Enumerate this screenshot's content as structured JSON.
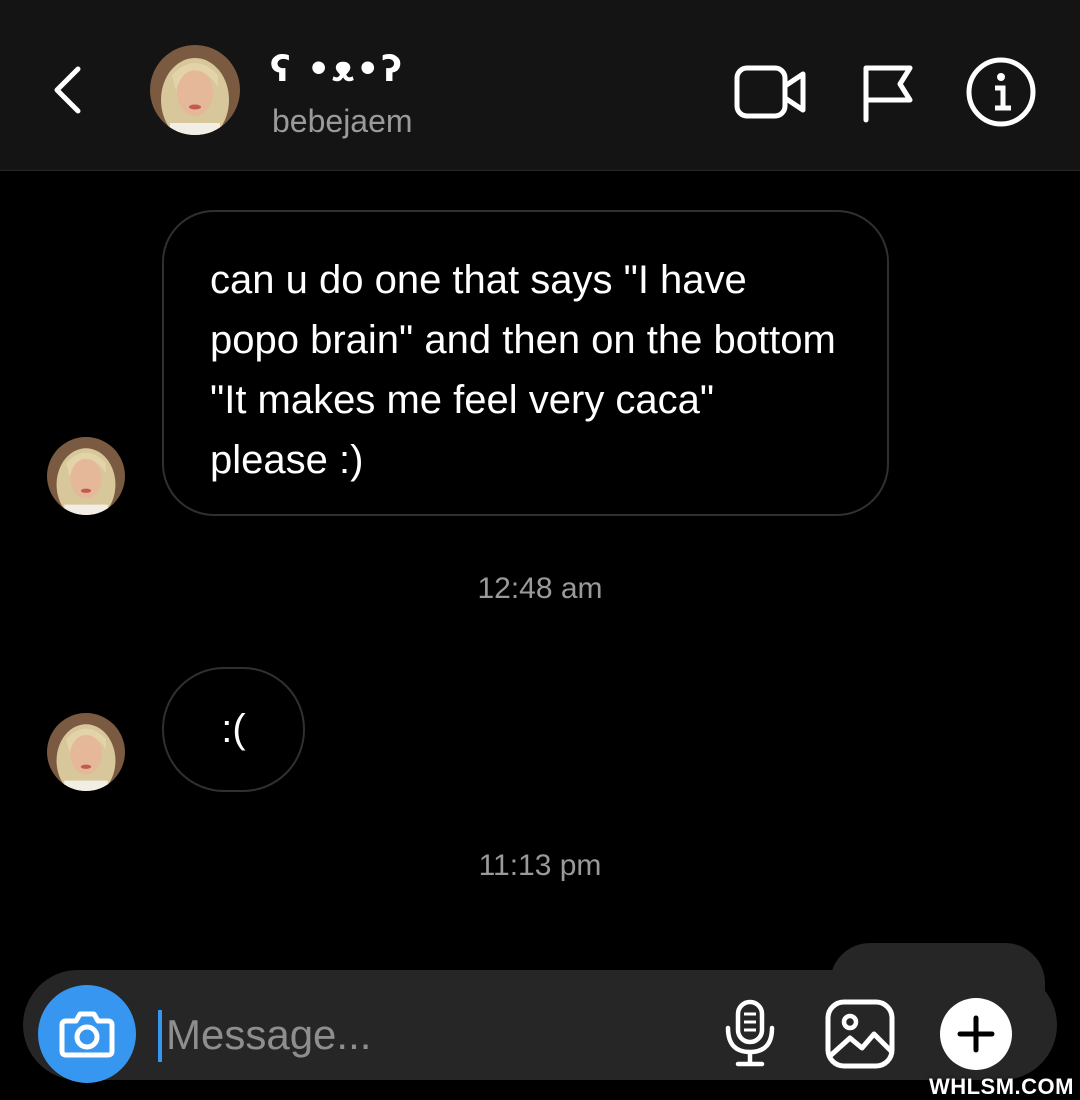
{
  "header": {
    "display_name": "ʕ •ᴥ•ʔ",
    "username": "bebejaem"
  },
  "messages": [
    {
      "text": "can u do one that says \"I have popo brain\" and then on the bottom \"It makes me feel very caca\" please :)"
    },
    {
      "text": ":("
    }
  ],
  "timestamps": [
    "12:48 am",
    "11:13 pm"
  ],
  "composer": {
    "placeholder": "Message..."
  },
  "watermark": "WHLSM.COM",
  "colors": {
    "accent": "#3797f0",
    "header_bg": "#141414",
    "background": "#000000",
    "bubble_border": "#303030",
    "muted_text": "#9a9a9a"
  },
  "icons": [
    "chevron-left-icon",
    "video-camera-icon",
    "flag-icon",
    "info-icon",
    "camera-icon",
    "microphone-icon",
    "image-icon",
    "plus-icon"
  ]
}
